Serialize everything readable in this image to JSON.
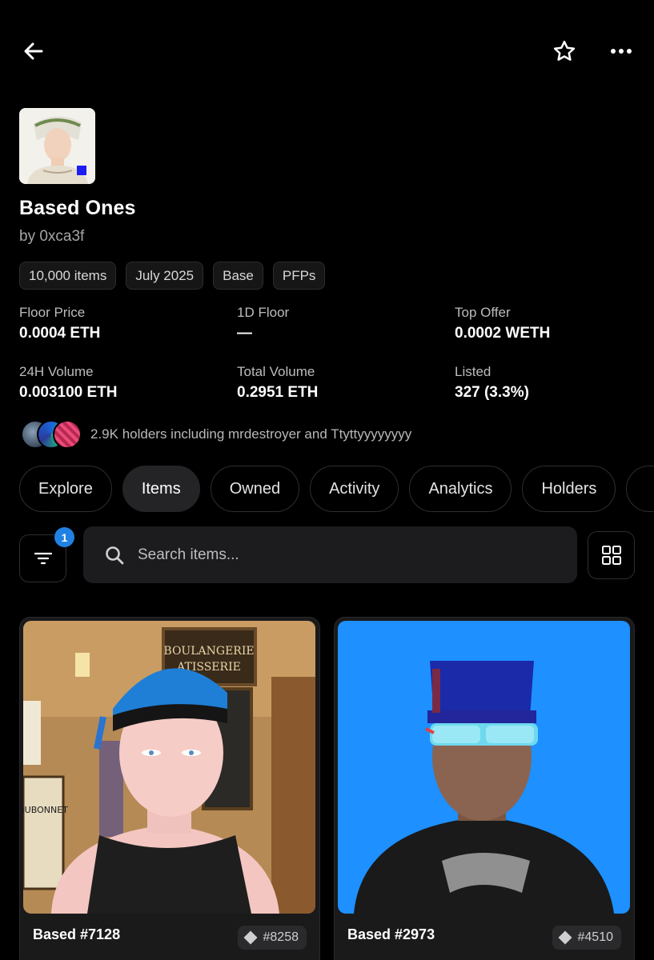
{
  "header": {
    "back_icon": "arrow-left-icon",
    "favorite_icon": "star-outline-icon",
    "more_icon": "more-horizontal-icon"
  },
  "collection": {
    "name": "Based Ones",
    "creator": "by 0xca3f",
    "tags": [
      "10,000 items",
      "July 2025",
      "Base",
      "PFPs"
    ]
  },
  "stats": [
    {
      "label": "Floor Price",
      "value": "0.0004 ETH"
    },
    {
      "label": "1D Floor",
      "value": "—"
    },
    {
      "label": "Top Offer",
      "value": "0.0002 WETH"
    },
    {
      "label": "24H Volume",
      "value": "0.003100 ETH"
    },
    {
      "label": "Total Volume",
      "value": "0.2951 ETH"
    },
    {
      "label": "Listed",
      "value": "327 (3.3%)"
    }
  ],
  "holders": {
    "text": "2.9K holders including mrdestroyer and Ttyttyyyyyyyy"
  },
  "tabs": [
    {
      "label": "Explore",
      "active": false
    },
    {
      "label": "Items",
      "active": true
    },
    {
      "label": "Owned",
      "active": false
    },
    {
      "label": "Activity",
      "active": false
    },
    {
      "label": "Analytics",
      "active": false
    },
    {
      "label": "Holders",
      "active": false
    },
    {
      "label": "",
      "active": false
    }
  ],
  "toolbar": {
    "filter_count": "1",
    "search_placeholder": "Search items...",
    "filter_icon": "filter-icon",
    "search_icon": "search-icon",
    "grid_icon": "grid-view-icon"
  },
  "items": [
    {
      "name": "Based #7128",
      "rank": "#8258"
    },
    {
      "name": "Based #2973",
      "rank": "#4510"
    }
  ],
  "colors": {
    "background": "#000000",
    "accent_badge": "#2081e2",
    "surface": "#1c1c1e",
    "card2_bg": "#1e90ff"
  }
}
